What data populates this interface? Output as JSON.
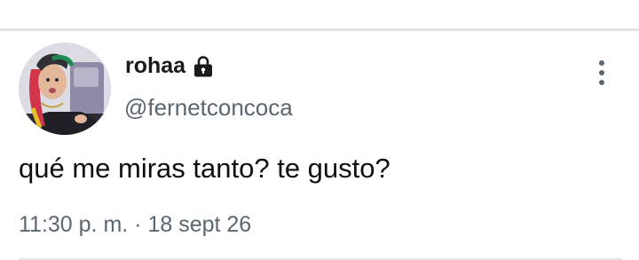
{
  "tweet": {
    "display_name": "rohaa",
    "handle": "@fernetconcoca",
    "text": "qué me miras tanto? te gusto?",
    "time": "11:30 p. m.",
    "separator": "·",
    "date": "18 sept 26",
    "protected_icon": "lock-icon",
    "more_icon": "more-vertical-icon"
  },
  "colors": {
    "name": "#1a1a1a",
    "secondary_text": "#5b6670",
    "body_text": "#0f0f0f",
    "divider": "#e3e3e3"
  }
}
